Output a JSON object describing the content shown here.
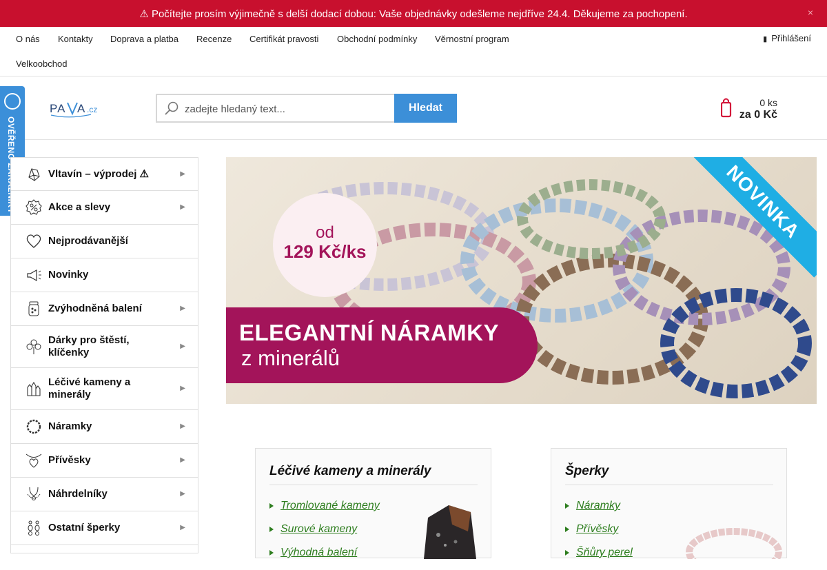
{
  "alert": {
    "text": "⚠ Počítejte prosím výjimečně s delší dodací dobou: Vaše objednávky odešleme nejdříve 24.4. Děkujeme za pochopení.",
    "close_icon": "×"
  },
  "topnav": {
    "links": [
      "O nás",
      "Kontakty",
      "Doprava a platba",
      "Recenze",
      "Certifikát pravosti",
      "Obchodní podmínky",
      "Věrnostní program",
      "Velkoobchod"
    ],
    "login": "Přihlášení"
  },
  "header": {
    "logo_text": "PAVA.cz",
    "search_placeholder": "zadejte hledaný text...",
    "search_button": "Hledat",
    "cart_count": "0 ks",
    "cart_sum": "za 0 Kč"
  },
  "side_badge": {
    "text": "OVĚŘENO ZÁKAZNÍKY"
  },
  "menu": [
    {
      "label": "Vltavín – výprodej ⚠",
      "icon": "crystal-icon",
      "arrow": true
    },
    {
      "label": "Akce a slevy",
      "icon": "percent-icon",
      "arrow": true
    },
    {
      "label": "Nejprodávanější",
      "icon": "heart-icon",
      "arrow": false
    },
    {
      "label": "Novinky",
      "icon": "megaphone-icon",
      "arrow": false
    },
    {
      "label": "Zvýhodněná balení",
      "icon": "jar-icon",
      "arrow": true
    },
    {
      "label": "Dárky pro štěstí, klíčenky",
      "icon": "clover-icon",
      "arrow": true
    },
    {
      "label": "Léčivé kameny a minerály",
      "icon": "crystals-icon",
      "arrow": true
    },
    {
      "label": "Náramky",
      "icon": "bracelet-icon",
      "arrow": true
    },
    {
      "label": "Přívěsky",
      "icon": "pendant-icon",
      "arrow": true
    },
    {
      "label": "Náhrdelníky",
      "icon": "necklace-icon",
      "arrow": true
    },
    {
      "label": "Ostatní šperky",
      "icon": "earrings-icon",
      "arrow": true
    }
  ],
  "banner": {
    "ribbon": "NOVINKA",
    "price_from": "od",
    "price": "129 Kč/ks",
    "headline": "ELEGANTNÍ NÁRAMKY",
    "subline": "z minerálů",
    "colors": {
      "pill": "#a3145a",
      "ribbon": "#1faee4"
    }
  },
  "cards": [
    {
      "title": "Léčivé kameny a minerály",
      "links": [
        "Tromlované kameny",
        "Surové kameny",
        "Výhodná balení"
      ]
    },
    {
      "title": "Šperky",
      "links": [
        "Náramky",
        "Přívěsky",
        "Šňůry perel"
      ]
    }
  ]
}
